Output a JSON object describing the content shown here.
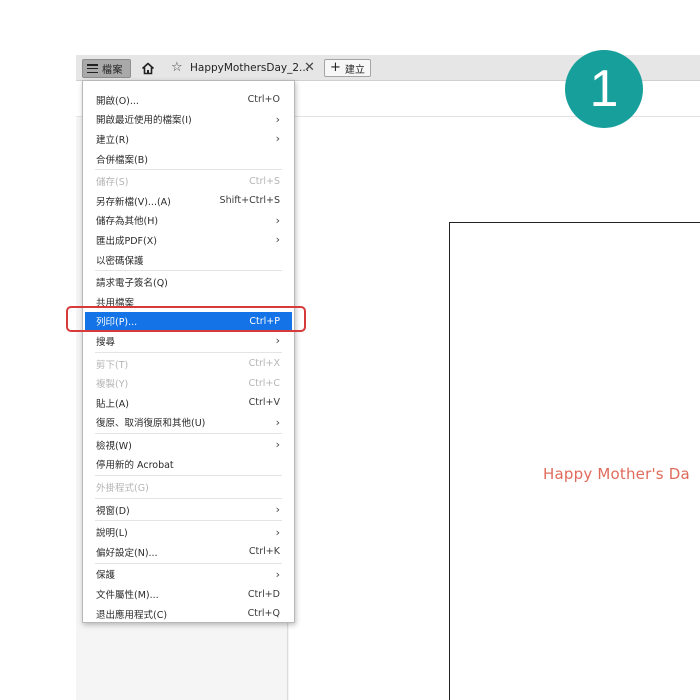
{
  "tabbar": {
    "menu_label": "檔案",
    "tab_title": "HappyMothersDay_2...",
    "new_label": "建立"
  },
  "document": {
    "page_text": "Happy Mother's Da"
  },
  "badge": {
    "number": "1",
    "color": "#169f9b"
  },
  "menu": {
    "sections": [
      [
        {
          "label": "開啟(O)...",
          "shortcut": "Ctrl+O",
          "submenu": false,
          "disabled": false
        },
        {
          "label": "開啟最近使用的檔案(I)",
          "shortcut": "",
          "submenu": true,
          "disabled": false
        },
        {
          "label": "建立(R)",
          "shortcut": "",
          "submenu": true,
          "disabled": false
        },
        {
          "label": "合併檔案(B)",
          "shortcut": "",
          "submenu": false,
          "disabled": false
        }
      ],
      [
        {
          "label": "儲存(S)",
          "shortcut": "Ctrl+S",
          "submenu": false,
          "disabled": true
        },
        {
          "label": "另存新檔(V)...(A)",
          "shortcut": "Shift+Ctrl+S",
          "submenu": false,
          "disabled": false
        },
        {
          "label": "儲存為其他(H)",
          "shortcut": "",
          "submenu": true,
          "disabled": false
        },
        {
          "label": "匯出成PDF(X)",
          "shortcut": "",
          "submenu": true,
          "disabled": false
        },
        {
          "label": "以密碼保護",
          "shortcut": "",
          "submenu": false,
          "disabled": false
        }
      ],
      [
        {
          "label": "請求電子簽名(Q)",
          "shortcut": "",
          "submenu": false,
          "disabled": false
        },
        {
          "label": "共用檔案",
          "shortcut": "",
          "submenu": false,
          "disabled": false
        },
        {
          "label": "列印(P)...",
          "shortcut": "Ctrl+P",
          "submenu": false,
          "disabled": false,
          "active": true
        },
        {
          "label": "搜尋",
          "shortcut": "",
          "submenu": true,
          "disabled": false
        }
      ],
      [
        {
          "label": "剪下(T)",
          "shortcut": "Ctrl+X",
          "submenu": false,
          "disabled": true
        },
        {
          "label": "複製(Y)",
          "shortcut": "Ctrl+C",
          "submenu": false,
          "disabled": true
        },
        {
          "label": "貼上(A)",
          "shortcut": "Ctrl+V",
          "submenu": false,
          "disabled": false
        },
        {
          "label": "復原、取消復原和其他(U)",
          "shortcut": "",
          "submenu": true,
          "disabled": false
        }
      ],
      [
        {
          "label": "檢視(W)",
          "shortcut": "",
          "submenu": true,
          "disabled": false
        },
        {
          "label": "停用新的 Acrobat",
          "shortcut": "",
          "submenu": false,
          "disabled": false
        }
      ],
      [
        {
          "label": "外掛程式(G)",
          "shortcut": "",
          "submenu": false,
          "disabled": true
        }
      ],
      [
        {
          "label": "視窗(D)",
          "shortcut": "",
          "submenu": true,
          "disabled": false
        }
      ],
      [
        {
          "label": "說明(L)",
          "shortcut": "",
          "submenu": true,
          "disabled": false
        },
        {
          "label": "偏好設定(N)...",
          "shortcut": "Ctrl+K",
          "submenu": false,
          "disabled": false
        }
      ],
      [
        {
          "label": "保護",
          "shortcut": "",
          "submenu": true,
          "disabled": false
        },
        {
          "label": "文件屬性(M)...",
          "shortcut": "Ctrl+D",
          "submenu": false,
          "disabled": false
        },
        {
          "label": "退出應用程式(C)",
          "shortcut": "Ctrl+Q",
          "submenu": false,
          "disabled": false
        }
      ]
    ]
  },
  "highlight_color": "#d63a3a",
  "active_color": "#1473e6"
}
